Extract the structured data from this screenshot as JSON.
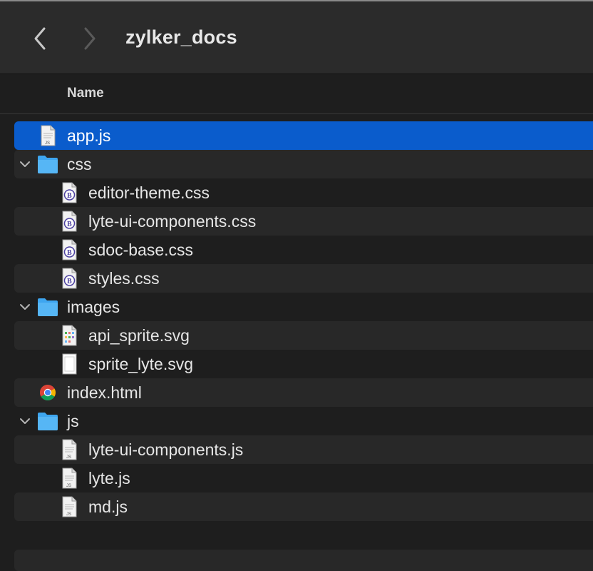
{
  "window": {
    "title": "zylker_docs"
  },
  "columns": {
    "name": "Name"
  },
  "rows": [
    {
      "label": "app.js",
      "kind": "file",
      "icon": "js-file-icon",
      "level": 0,
      "selected": true
    },
    {
      "label": "css",
      "kind": "folder",
      "icon": "folder-icon",
      "level": 0,
      "expanded": true
    },
    {
      "label": "editor-theme.css",
      "kind": "file",
      "icon": "css-file-icon",
      "level": 1
    },
    {
      "label": "lyte-ui-components.css",
      "kind": "file",
      "icon": "css-file-icon",
      "level": 1
    },
    {
      "label": "sdoc-base.css",
      "kind": "file",
      "icon": "css-file-icon",
      "level": 1
    },
    {
      "label": "styles.css",
      "kind": "file",
      "icon": "css-file-icon",
      "level": 1
    },
    {
      "label": "images",
      "kind": "folder",
      "icon": "folder-icon",
      "level": 0,
      "expanded": true
    },
    {
      "label": "api_sprite.svg",
      "kind": "file",
      "icon": "svg-file-icon",
      "level": 1
    },
    {
      "label": "sprite_lyte.svg",
      "kind": "file",
      "icon": "svg-blank-file-icon",
      "level": 1
    },
    {
      "label": "index.html",
      "kind": "file",
      "icon": "chrome-html-icon",
      "level": 0
    },
    {
      "label": "js",
      "kind": "folder",
      "icon": "folder-icon",
      "level": 0,
      "expanded": true
    },
    {
      "label": "lyte-ui-components.js",
      "kind": "file",
      "icon": "js-file-icon",
      "level": 1
    },
    {
      "label": "lyte.js",
      "kind": "file",
      "icon": "js-file-icon",
      "level": 1
    },
    {
      "label": "md.js",
      "kind": "file",
      "icon": "js-file-icon",
      "level": 1
    }
  ],
  "colors": {
    "selection": "#0a5ccc",
    "folder": "#3ea6f0",
    "background": "#1e1e1e",
    "stripe": "#282828"
  },
  "icons": {
    "back": "chevron-left-icon",
    "forward": "chevron-right-icon",
    "disclosure": "chevron-down-icon"
  }
}
